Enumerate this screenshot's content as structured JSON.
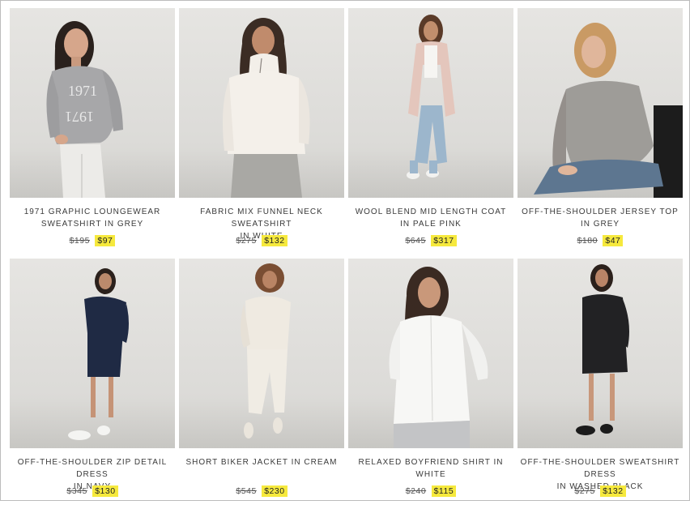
{
  "products": [
    {
      "line1": "1971 GRAPHIC LOUNGEWEAR",
      "line2": "SWEATSHIRT IN GREY",
      "old_price": "$195",
      "new_price": "$97",
      "image": "model-grey-graphic-sweatshirt"
    },
    {
      "line1": "FABRIC MIX FUNNEL NECK SWEATSHIRT",
      "line2": "IN WHITE",
      "old_price": "$275",
      "new_price": "$132",
      "image": "model-white-funnel-neck"
    },
    {
      "line1": "WOOL BLEND MID LENGTH COAT",
      "line2": "IN PALE PINK",
      "old_price": "$645",
      "new_price": "$317",
      "image": "model-pink-coat"
    },
    {
      "line1": "OFF-THE-SHOULDER JERSEY TOP",
      "line2": "IN GREY",
      "old_price": "$180",
      "new_price": "$47",
      "image": "model-grey-jersey-top"
    },
    {
      "line1": "OFF-THE-SHOULDER ZIP DETAIL DRESS",
      "line2": "IN NAVY",
      "old_price": "$345",
      "new_price": "$130",
      "image": "model-navy-dress"
    },
    {
      "line1": "SHORT BIKER JACKET IN CREAM",
      "line2": "",
      "old_price": "$545",
      "new_price": "$230",
      "image": "model-cream-biker-jacket"
    },
    {
      "line1": "RELAXED BOYFRIEND SHIRT IN WHITE",
      "line2": "",
      "old_price": "$240",
      "new_price": "$115",
      "image": "model-white-shirt"
    },
    {
      "line1": "OFF-THE-SHOULDER SWEATSHIRT DRESS",
      "line2": "IN WASHED BLACK",
      "old_price": "$275",
      "new_price": "$132",
      "image": "model-black-sweatshirt-dress"
    }
  ],
  "colors": {
    "sale_highlight": "#f6e93d",
    "photo_background": "#e0dfdc"
  }
}
